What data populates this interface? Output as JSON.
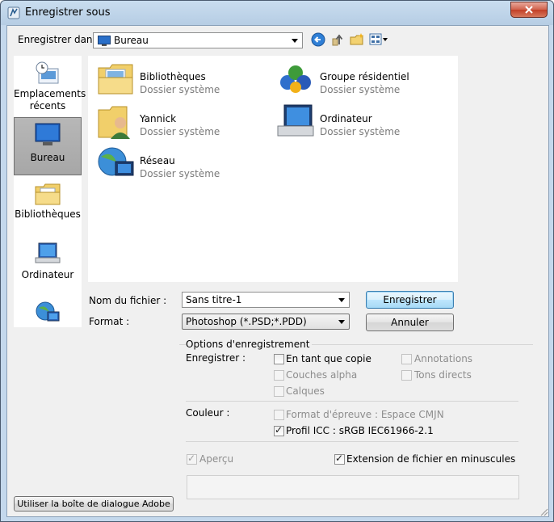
{
  "window": {
    "title": "Enregistrer sous",
    "app_icon": "photoshop-icon",
    "close_icon": "close-icon"
  },
  "location": {
    "label": "Enregistrer dans :",
    "value": "Bureau",
    "value_icon": "desktop-icon",
    "toolbar_icons": [
      "back-icon",
      "up-folder-icon",
      "new-folder-icon",
      "view-menu-icon"
    ]
  },
  "places": [
    {
      "label": "Emplacements récents",
      "icon": "recent-places-icon",
      "selected": false
    },
    {
      "label": "Bureau",
      "icon": "desktop-icon",
      "selected": true
    },
    {
      "label": "Bibliothèques",
      "icon": "libraries-icon",
      "selected": false
    },
    {
      "label": "Ordinateur",
      "icon": "computer-icon",
      "selected": false
    },
    {
      "label": "",
      "icon": "network-icon",
      "selected": false
    }
  ],
  "items": [
    {
      "name": "Bibliothèques",
      "sub": "Dossier système",
      "icon": "libraries-icon"
    },
    {
      "name": "Groupe résidentiel",
      "sub": "Dossier système",
      "icon": "homegroup-icon"
    },
    {
      "name": "Yannick",
      "sub": "Dossier système",
      "icon": "user-folder-icon"
    },
    {
      "name": "Ordinateur",
      "sub": "Dossier système",
      "icon": "computer-icon"
    },
    {
      "name": "Réseau",
      "sub": "Dossier système",
      "icon": "network-icon"
    }
  ],
  "file": {
    "name_label": "Nom du fichier :",
    "name_value": "Sans titre-1",
    "format_label": "Format :",
    "format_value": "Photoshop (*.PSD;*.PDD)"
  },
  "buttons": {
    "save": "Enregistrer",
    "cancel": "Annuler",
    "adobe": "Utiliser la boîte de dialogue Adobe"
  },
  "options": {
    "title": "Options d'enregistrement",
    "save_label": "Enregistrer :",
    "save_opts": [
      {
        "label": "En tant que copie",
        "checked": false,
        "enabled": true
      },
      {
        "label": "Annotations",
        "checked": false,
        "enabled": false
      },
      {
        "label": "Couches alpha",
        "checked": false,
        "enabled": false
      },
      {
        "label": "Tons directs",
        "checked": false,
        "enabled": false
      },
      {
        "label": "Calques",
        "checked": false,
        "enabled": false
      }
    ],
    "color_label": "Couleur :",
    "color_opts": [
      {
        "label": "Format d'épreuve : Espace CMJN",
        "checked": false,
        "enabled": false
      },
      {
        "label": "Profil ICC : sRGB IEC61966-2.1",
        "checked": true,
        "enabled": true
      }
    ],
    "preview": {
      "label": "Aperçu",
      "checked": true,
      "enabled": false
    },
    "extension": {
      "label": "Extension de fichier en minuscules",
      "checked": true,
      "enabled": true
    }
  },
  "colors": {
    "accent": "#3c7fb1",
    "titlebar": "#b6cde4",
    "close": "#c23f27",
    "disabled_text": "#8d8d8d"
  }
}
